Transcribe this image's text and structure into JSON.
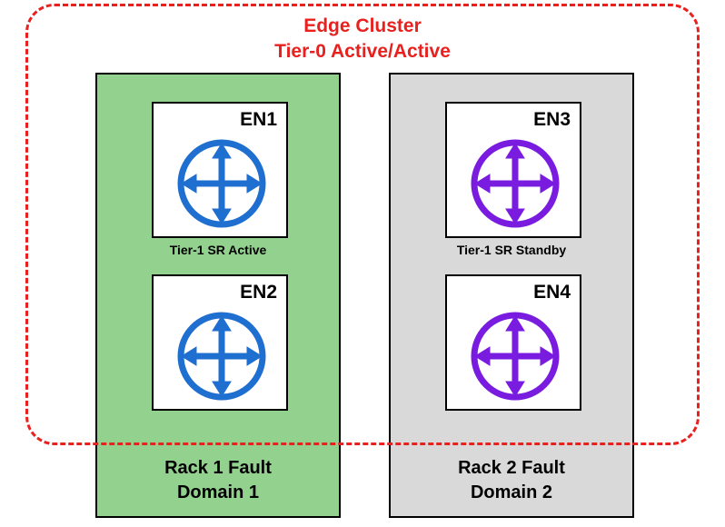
{
  "cluster": {
    "line1": "Edge Cluster",
    "line2": "Tier-0 Active/Active"
  },
  "racks": {
    "rack1": {
      "labelLine1": "Rack 1 Fault",
      "labelLine2": "Domain 1",
      "node1Label": "EN1",
      "node2Label": "EN2",
      "tierLabel": "Tier-1 SR Active",
      "iconColor": "#1f6fd1"
    },
    "rack2": {
      "labelLine1": "Rack 2 Fault",
      "labelLine2": "Domain 2",
      "node1Label": "EN3",
      "node2Label": "EN4",
      "tierLabel": "Tier-1 SR Standby",
      "iconColor": "#7a1be0"
    }
  }
}
